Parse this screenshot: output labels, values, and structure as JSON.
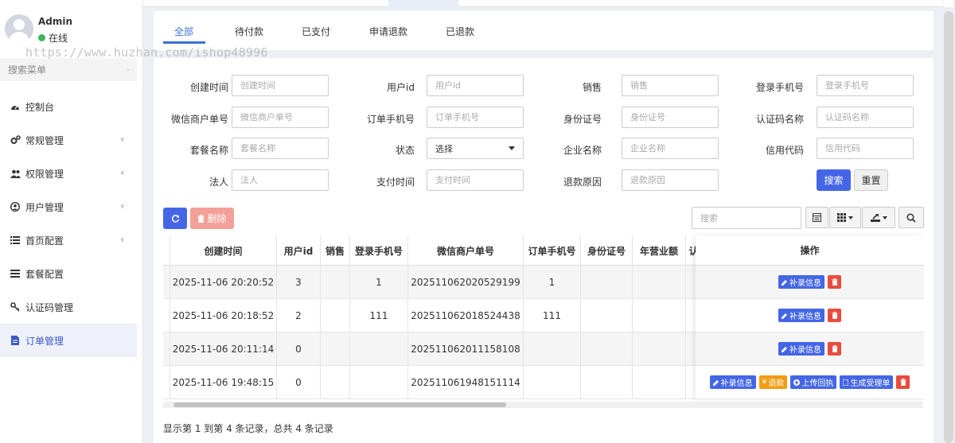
{
  "sidebar": {
    "user": {
      "name": "Admin",
      "status": "在线"
    },
    "watermark": "https://www.huzhan.com/ishop48996",
    "search_placeholder": "搜索菜单",
    "items": [
      {
        "label": "控制台",
        "icon": "dashboard-icon",
        "has_children": false
      },
      {
        "label": "常规管理",
        "icon": "cogs-icon",
        "has_children": true
      },
      {
        "label": "权限管理",
        "icon": "users-icon",
        "has_children": true
      },
      {
        "label": "用户管理",
        "icon": "user-circle-icon",
        "has_children": true
      },
      {
        "label": "首页配置",
        "icon": "list-icon",
        "has_children": true
      },
      {
        "label": "套餐配置",
        "icon": "bars-icon",
        "has_children": false
      },
      {
        "label": "认证码管理",
        "icon": "key-icon",
        "has_children": false
      },
      {
        "label": "订单管理",
        "icon": "file-icon",
        "has_children": false,
        "active": true
      }
    ]
  },
  "tabs": [
    "全部",
    "待付款",
    "已支付",
    "申请退款",
    "已退款"
  ],
  "filters": {
    "rows": [
      [
        {
          "label": "创建时间",
          "placeholder": "创建时间"
        },
        {
          "label": "用户id",
          "placeholder": "用户id"
        },
        {
          "label": "销售",
          "placeholder": "销售"
        },
        {
          "label": "登录手机号",
          "placeholder": "登录手机号"
        }
      ],
      [
        {
          "label": "微信商户单号",
          "placeholder": "微信商户单号"
        },
        {
          "label": "订单手机号",
          "placeholder": "订单手机号"
        },
        {
          "label": "身份证号",
          "placeholder": "身份证号"
        },
        {
          "label": "认证码名称",
          "placeholder": "认证码名称"
        }
      ],
      [
        {
          "label": "套餐名称",
          "placeholder": "套餐名称"
        },
        {
          "label": "状态",
          "select_value": "选择"
        },
        {
          "label": "企业名称",
          "placeholder": "企业名称"
        },
        {
          "label": "信用代码",
          "placeholder": "信用代码"
        }
      ],
      [
        {
          "label": "法人",
          "placeholder": "法人"
        },
        {
          "label": "支付时间",
          "placeholder": "支付时间"
        },
        {
          "label": "退款原因",
          "placeholder": "退款原因"
        }
      ]
    ],
    "search_label": "搜索",
    "reset_label": "重置"
  },
  "toolbar": {
    "delete_label": "删除",
    "search_placeholder": "搜索"
  },
  "table": {
    "columns": [
      "创建时间",
      "用户id",
      "销售",
      "登录手机号",
      "微信商户单号",
      "订单手机号",
      "身份证号",
      "年营业额",
      "认"
    ],
    "ops_header": "操作",
    "rows": [
      {
        "cells": [
          "2025-11-06 20:20:52",
          "3",
          "",
          "1",
          "202511062020529199",
          "1",
          "",
          "",
          ""
        ],
        "ops": [
          "补录信息"
        ]
      },
      {
        "cells": [
          "2025-11-06 20:18:52",
          "2",
          "",
          "111",
          "202511062018524438",
          "111",
          "",
          "",
          ""
        ],
        "ops": [
          "补录信息"
        ]
      },
      {
        "cells": [
          "2025-11-06 20:11:14",
          "0",
          "",
          "",
          "202511062011158108",
          "",
          "",
          "",
          ""
        ],
        "ops": [
          "补录信息"
        ]
      },
      {
        "cells": [
          "2025-11-06 19:48:15",
          "0",
          "",
          "",
          "202511061948151114",
          "",
          "",
          "",
          ""
        ],
        "ops": [
          "补录信息",
          "退款",
          "上传回执",
          "生成受理单"
        ]
      }
    ]
  },
  "pagination_text": "显示第 1 到第 4 条记录，总共 4 条记录",
  "colors": {
    "primary": "#4466e6",
    "danger": "#e84c3d",
    "warning": "#f39c12",
    "tab_active": "#3a6fd8"
  }
}
